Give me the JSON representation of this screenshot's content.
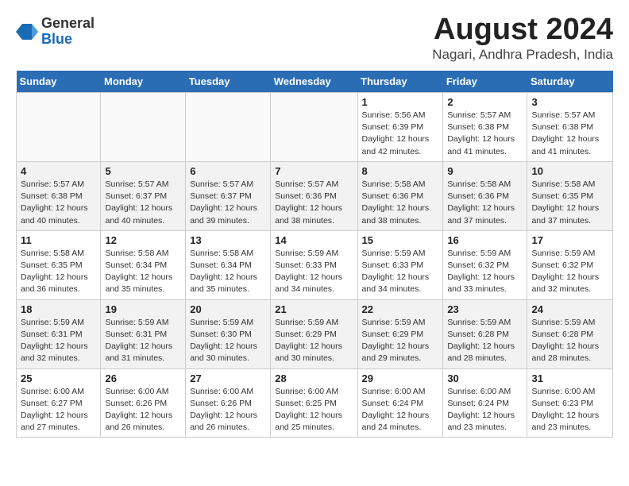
{
  "header": {
    "logo_general": "General",
    "logo_blue": "Blue",
    "month_year": "August 2024",
    "location": "Nagari, Andhra Pradesh, India"
  },
  "days_of_week": [
    "Sunday",
    "Monday",
    "Tuesday",
    "Wednesday",
    "Thursday",
    "Friday",
    "Saturday"
  ],
  "weeks": [
    [
      {
        "day": "",
        "info": ""
      },
      {
        "day": "",
        "info": ""
      },
      {
        "day": "",
        "info": ""
      },
      {
        "day": "",
        "info": ""
      },
      {
        "day": "1",
        "info": "Sunrise: 5:56 AM\nSunset: 6:39 PM\nDaylight: 12 hours\nand 42 minutes."
      },
      {
        "day": "2",
        "info": "Sunrise: 5:57 AM\nSunset: 6:38 PM\nDaylight: 12 hours\nand 41 minutes."
      },
      {
        "day": "3",
        "info": "Sunrise: 5:57 AM\nSunset: 6:38 PM\nDaylight: 12 hours\nand 41 minutes."
      }
    ],
    [
      {
        "day": "4",
        "info": "Sunrise: 5:57 AM\nSunset: 6:38 PM\nDaylight: 12 hours\nand 40 minutes."
      },
      {
        "day": "5",
        "info": "Sunrise: 5:57 AM\nSunset: 6:37 PM\nDaylight: 12 hours\nand 40 minutes."
      },
      {
        "day": "6",
        "info": "Sunrise: 5:57 AM\nSunset: 6:37 PM\nDaylight: 12 hours\nand 39 minutes."
      },
      {
        "day": "7",
        "info": "Sunrise: 5:57 AM\nSunset: 6:36 PM\nDaylight: 12 hours\nand 38 minutes."
      },
      {
        "day": "8",
        "info": "Sunrise: 5:58 AM\nSunset: 6:36 PM\nDaylight: 12 hours\nand 38 minutes."
      },
      {
        "day": "9",
        "info": "Sunrise: 5:58 AM\nSunset: 6:36 PM\nDaylight: 12 hours\nand 37 minutes."
      },
      {
        "day": "10",
        "info": "Sunrise: 5:58 AM\nSunset: 6:35 PM\nDaylight: 12 hours\nand 37 minutes."
      }
    ],
    [
      {
        "day": "11",
        "info": "Sunrise: 5:58 AM\nSunset: 6:35 PM\nDaylight: 12 hours\nand 36 minutes."
      },
      {
        "day": "12",
        "info": "Sunrise: 5:58 AM\nSunset: 6:34 PM\nDaylight: 12 hours\nand 35 minutes."
      },
      {
        "day": "13",
        "info": "Sunrise: 5:58 AM\nSunset: 6:34 PM\nDaylight: 12 hours\nand 35 minutes."
      },
      {
        "day": "14",
        "info": "Sunrise: 5:59 AM\nSunset: 6:33 PM\nDaylight: 12 hours\nand 34 minutes."
      },
      {
        "day": "15",
        "info": "Sunrise: 5:59 AM\nSunset: 6:33 PM\nDaylight: 12 hours\nand 34 minutes."
      },
      {
        "day": "16",
        "info": "Sunrise: 5:59 AM\nSunset: 6:32 PM\nDaylight: 12 hours\nand 33 minutes."
      },
      {
        "day": "17",
        "info": "Sunrise: 5:59 AM\nSunset: 6:32 PM\nDaylight: 12 hours\nand 32 minutes."
      }
    ],
    [
      {
        "day": "18",
        "info": "Sunrise: 5:59 AM\nSunset: 6:31 PM\nDaylight: 12 hours\nand 32 minutes."
      },
      {
        "day": "19",
        "info": "Sunrise: 5:59 AM\nSunset: 6:31 PM\nDaylight: 12 hours\nand 31 minutes."
      },
      {
        "day": "20",
        "info": "Sunrise: 5:59 AM\nSunset: 6:30 PM\nDaylight: 12 hours\nand 30 minutes."
      },
      {
        "day": "21",
        "info": "Sunrise: 5:59 AM\nSunset: 6:29 PM\nDaylight: 12 hours\nand 30 minutes."
      },
      {
        "day": "22",
        "info": "Sunrise: 5:59 AM\nSunset: 6:29 PM\nDaylight: 12 hours\nand 29 minutes."
      },
      {
        "day": "23",
        "info": "Sunrise: 5:59 AM\nSunset: 6:28 PM\nDaylight: 12 hours\nand 28 minutes."
      },
      {
        "day": "24",
        "info": "Sunrise: 5:59 AM\nSunset: 6:28 PM\nDaylight: 12 hours\nand 28 minutes."
      }
    ],
    [
      {
        "day": "25",
        "info": "Sunrise: 6:00 AM\nSunset: 6:27 PM\nDaylight: 12 hours\nand 27 minutes."
      },
      {
        "day": "26",
        "info": "Sunrise: 6:00 AM\nSunset: 6:26 PM\nDaylight: 12 hours\nand 26 minutes."
      },
      {
        "day": "27",
        "info": "Sunrise: 6:00 AM\nSunset: 6:26 PM\nDaylight: 12 hours\nand 26 minutes."
      },
      {
        "day": "28",
        "info": "Sunrise: 6:00 AM\nSunset: 6:25 PM\nDaylight: 12 hours\nand 25 minutes."
      },
      {
        "day": "29",
        "info": "Sunrise: 6:00 AM\nSunset: 6:24 PM\nDaylight: 12 hours\nand 24 minutes."
      },
      {
        "day": "30",
        "info": "Sunrise: 6:00 AM\nSunset: 6:24 PM\nDaylight: 12 hours\nand 23 minutes."
      },
      {
        "day": "31",
        "info": "Sunrise: 6:00 AM\nSunset: 6:23 PM\nDaylight: 12 hours\nand 23 minutes."
      }
    ]
  ]
}
